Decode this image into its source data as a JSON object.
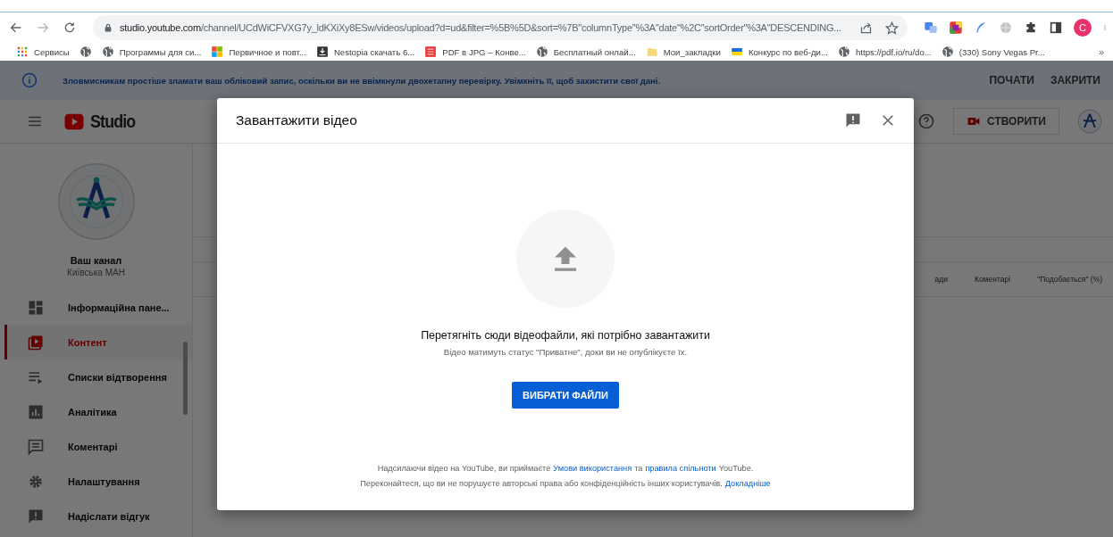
{
  "browser": {
    "url_host": "studio.youtube.com",
    "url_path": "/channel/UCdWiCFVXG7y_ldKXiXy8ESw/videos/upload?d=ud&filter=%5B%5D&sort=%7B\"columnType\"%3A\"date\"%2C\"sortOrder\"%3A\"DESCENDING...",
    "profile_initial": "C",
    "bookmarks": [
      {
        "kind": "apps",
        "label": "Сервисы"
      },
      {
        "kind": "globe"
      },
      {
        "kind": "globe",
        "label": "Программы для си..."
      },
      {
        "kind": "tiles",
        "label": "Первичное и повт..."
      },
      {
        "kind": "download",
        "label": "Nestopia скачать 6..."
      },
      {
        "kind": "pdf",
        "label": "PDF в JPG – Конве..."
      },
      {
        "kind": "globe",
        "label": "Бесплатный онлай..."
      },
      {
        "kind": "folder",
        "label": "Мои_закладки"
      },
      {
        "kind": "flag",
        "label": "Конкурс по веб-ди..."
      },
      {
        "kind": "globe",
        "label": "https://pdf.io/ru/do..."
      },
      {
        "kind": "globe",
        "label": "(330) Sony Vegas Pr..."
      }
    ],
    "more": "»"
  },
  "banner": {
    "text": "Зловмисникам простіше зламати ваш обліковий запис, оскільки ви не ввімкнули двохетапну перевірку. Увімкніть її, щоб захистити свої дані.",
    "actions": [
      "ПОЧАТИ",
      "ЗАКРИТИ"
    ]
  },
  "header": {
    "logo_text": "Studio",
    "create_label": "СТВОРИТИ"
  },
  "sidebar": {
    "channel_title": "Ваш канал",
    "channel_name": "Київська МАН",
    "items": [
      {
        "kind": "dashboard",
        "label": "Інформаційна пане...",
        "selected": false
      },
      {
        "kind": "content",
        "label": "Контент",
        "selected": true
      },
      {
        "kind": "playlists",
        "label": "Списки відтворення",
        "selected": false
      },
      {
        "kind": "analytics",
        "label": "Аналітика",
        "selected": false
      },
      {
        "kind": "comments",
        "label": "Коментарі",
        "selected": false
      },
      {
        "kind": "settings",
        "label": "Налаштування",
        "selected": false
      },
      {
        "kind": "feedback",
        "label": "Надіслати відгук",
        "selected": false
      }
    ]
  },
  "table": {
    "columns": [
      "ади",
      "Коментарі",
      "\"Подобається\" (%)"
    ]
  },
  "dialog": {
    "title": "Завантажити відео",
    "drop_text": "Перетягніть сюди відеофайли, які потрібно завантажити",
    "hint": "Відео матимуть статус \"Приватне\", доки ви не опублікуєте їх.",
    "select_button": "ВИБРАТИ ФАЙЛИ",
    "footer": [
      [
        {
          "kind": "text",
          "text": "Надсилаючи відео на YouTube, ви приймаєте"
        },
        {
          "kind": "link",
          "text": "Умови використання"
        },
        {
          "kind": "text",
          "text": "та"
        },
        {
          "kind": "link",
          "text": "правила спільноти"
        },
        {
          "kind": "text",
          "text": "YouTube."
        }
      ],
      [
        {
          "kind": "text",
          "text": "Переконайтеся, що ви не порушуєте авторські права або конфіденційність інших користувачів."
        },
        {
          "kind": "link",
          "text": "Докладніше"
        }
      ]
    ]
  }
}
